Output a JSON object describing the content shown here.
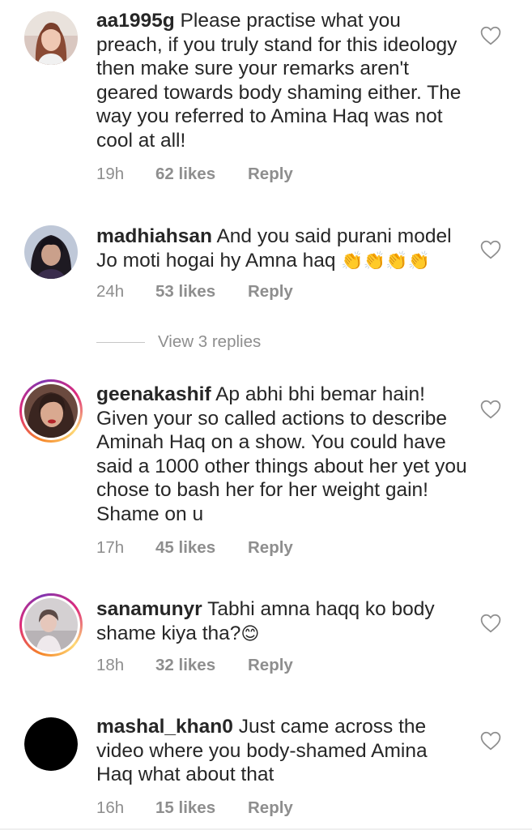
{
  "comments": [
    {
      "username": "aa1995g",
      "text": "Please practise what you preach, if you truly stand for this ideology then make sure your remarks aren't geared towards body shaming either. The way you referred to Amina Haq was not cool at all!",
      "emoji": "",
      "time": "19h",
      "likes": "62 likes",
      "reply": "Reply",
      "avatar_icon": "avatar-photo-icon",
      "story_ring": false
    },
    {
      "username": "madhiahsan",
      "text": "And you said purani model Jo moti hogai hy Amna haq",
      "emoji": "👏👏👏👏",
      "time": "24h",
      "likes": "53 likes",
      "reply": "Reply",
      "avatar_icon": "avatar-photo-icon",
      "story_ring": false
    },
    {
      "username": "geenakashif",
      "text": "Ap abhi bhi bemar hain! Given your so called actions to describe Aminah Haq on a show. You could have said a 1000 other things about her yet you chose to bash her for her weight gain! Shame on u",
      "emoji": "",
      "time": "17h",
      "likes": "45 likes",
      "reply": "Reply",
      "avatar_icon": "avatar-photo-icon",
      "story_ring": true
    },
    {
      "username": "sanamunyr",
      "text": "Tabhi amna haqq ko body shame kiya tha?",
      "emoji": "😊",
      "time": "18h",
      "likes": "32 likes",
      "reply": "Reply",
      "avatar_icon": "avatar-photo-icon",
      "story_ring": true
    },
    {
      "username": "mashal_khan0",
      "text": "Just came across the video where you body-shamed Amina Haq what about that",
      "emoji": "",
      "time": "16h",
      "likes": "15 likes",
      "reply": "Reply",
      "avatar_icon": "avatar-placeholder-icon",
      "story_ring": false
    }
  ],
  "view_replies": "View 3 replies",
  "like_icon": "heart-outline-icon",
  "colors": {
    "text": "#262626",
    "meta": "#8e8e8e",
    "story_ring_start": "#f58529",
    "story_ring_end": "#dd2a7b"
  }
}
